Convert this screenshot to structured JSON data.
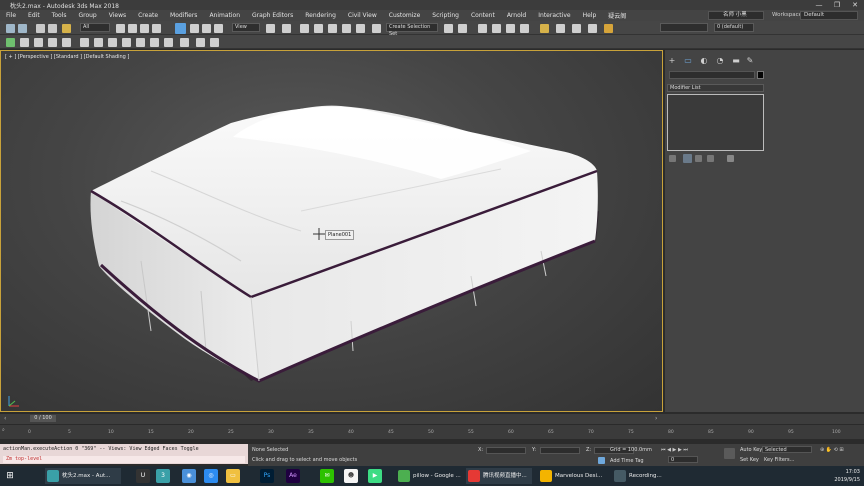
{
  "window": {
    "title": "枕头2.max - Autodesk 3ds Max 2018",
    "minimize": "—",
    "maximize": "❐",
    "close": "✕"
  },
  "menu": [
    "File",
    "Edit",
    "Tools",
    "Group",
    "Views",
    "Create",
    "Modifiers",
    "Animation",
    "Graph Editors",
    "Rendering",
    "Civil View",
    "Customize",
    "Scripting",
    "Content",
    "Arnold",
    "Interactive",
    "Help",
    "疑云阁"
  ],
  "user": "名师 小黑",
  "workspaces": {
    "label": "Workspaces:",
    "value": "Default"
  },
  "toolbar": {
    "selection_filter": "All",
    "ref_coord": "View",
    "named_selection": "Create Selection Set",
    "layer": "0 (default)"
  },
  "viewport": {
    "label": "[ + ] [Perspective ] [Standard ] [Default Shading ]",
    "tooltip": "Plane001"
  },
  "command_panel": {
    "modifier_list": "Modifier List",
    "tabs": [
      "+",
      "▭",
      "◐",
      "◔",
      "▬",
      "✎"
    ]
  },
  "timeline": {
    "frame": "0 / 100",
    "ticks": [
      "0",
      "5",
      "10",
      "15",
      "20",
      "25",
      "30",
      "35",
      "40",
      "45",
      "50",
      "55",
      "60",
      "65",
      "70",
      "75",
      "80",
      "85",
      "90",
      "95",
      "100"
    ]
  },
  "maxscript": {
    "line1": "actionMan.executeAction 0 \"369\"  -- Views: View Edged Faces Toggle",
    "line2": "Zm top-level"
  },
  "status": {
    "selection": "None Selected",
    "prompt": "Click and drag to select and move objects",
    "x_label": "X:",
    "y_label": "Y:",
    "z_label": "Z:",
    "grid": "Grid = 100.0mm",
    "add_time_tag": "Add Time Tag",
    "auto_key": "Auto Key",
    "set_key": "Set Key",
    "key_mode": "Selected",
    "key_filters": "Key Filters...",
    "frame_field": "0"
  },
  "taskbar": {
    "buttons": [
      {
        "label": "枕头2.max - Aut...",
        "color": "#3aa0a8"
      },
      {
        "label": "pillow - Google ...",
        "color": "#4caf50"
      },
      {
        "label": "腾讯视频直播中...",
        "color": "#e53935"
      },
      {
        "label": "Marvelous Desi...",
        "color": "#f4b400"
      },
      {
        "label": "Recording...",
        "color": "#455a64"
      }
    ],
    "time": "17:03",
    "date": "2019/9/15"
  }
}
